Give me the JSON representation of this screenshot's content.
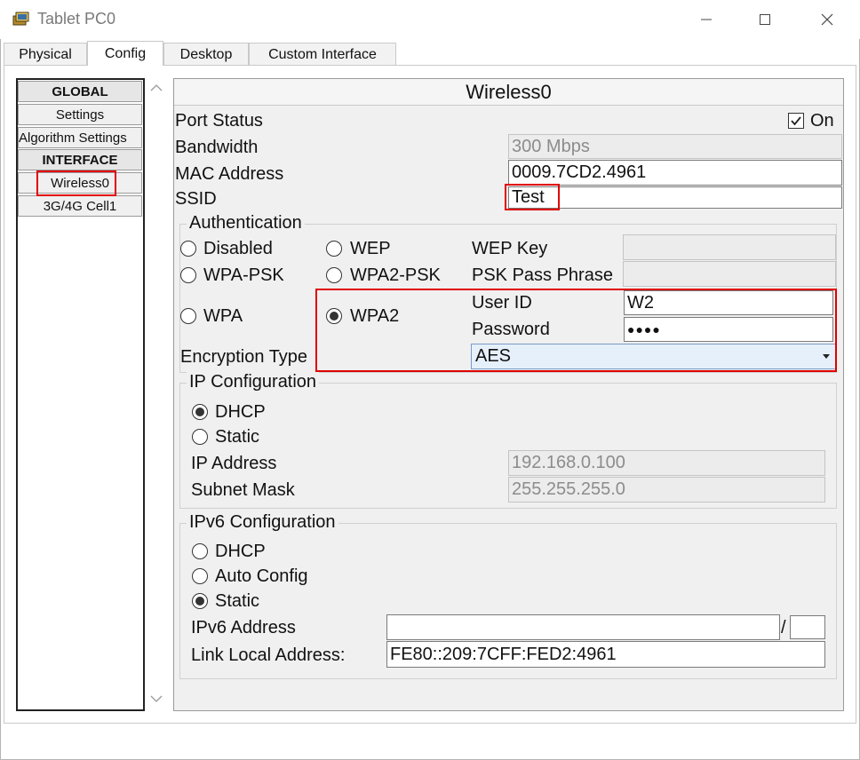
{
  "window": {
    "title": "Tablet PC0"
  },
  "tabs": [
    "Physical",
    "Config",
    "Desktop",
    "Custom Interface"
  ],
  "sidebar": {
    "global_header": "GLOBAL",
    "settings": "Settings",
    "algorithm_settings": "Algorithm Settings",
    "interface_header": "INTERFACE",
    "wireless0": "Wireless0",
    "cell": "3G/4G Cell1"
  },
  "panel": {
    "title": "Wireless0",
    "port_status_label": "Port Status",
    "port_status_checkbox": "On",
    "port_status_checked": true,
    "bandwidth_label": "Bandwidth",
    "bandwidth_value": "300 Mbps",
    "mac_label": "MAC Address",
    "mac_value": "0009.7CD2.4961",
    "ssid_label": "SSID",
    "ssid_value": "Test"
  },
  "auth": {
    "title": "Authentication",
    "disabled": "Disabled",
    "wep": "WEP",
    "wpa_psk": "WPA-PSK",
    "wpa2_psk": "WPA2-PSK",
    "wpa": "WPA",
    "wpa2": "WPA2",
    "selected": "WPA2",
    "wep_key_label": "WEP Key",
    "psk_label": "PSK Pass Phrase",
    "user_id_label": "User ID",
    "user_id_value": "W2",
    "password_label": "Password",
    "password_value": "●●●●",
    "encryption_label": "Encryption Type",
    "encryption_value": "AES"
  },
  "ip": {
    "title": "IP Configuration",
    "dhcp": "DHCP",
    "static": "Static",
    "selected": "DHCP",
    "ip_label": "IP Address",
    "ip_value": "192.168.0.100",
    "mask_label": "Subnet Mask",
    "mask_value": "255.255.255.0"
  },
  "ipv6": {
    "title": "IPv6 Configuration",
    "dhcp": "DHCP",
    "auto": "Auto Config",
    "static": "Static",
    "selected": "Static",
    "address_label": "IPv6 Address",
    "address_value": "",
    "slash": "/",
    "prefix_value": "",
    "link_local_label": "Link Local Address:",
    "link_local_value": "FE80::209:7CFF:FED2:4961"
  },
  "colors": {
    "highlight_red": "#e00000",
    "panel_bg": "#f0f0f0",
    "select_bg": "#e6f0fb"
  }
}
